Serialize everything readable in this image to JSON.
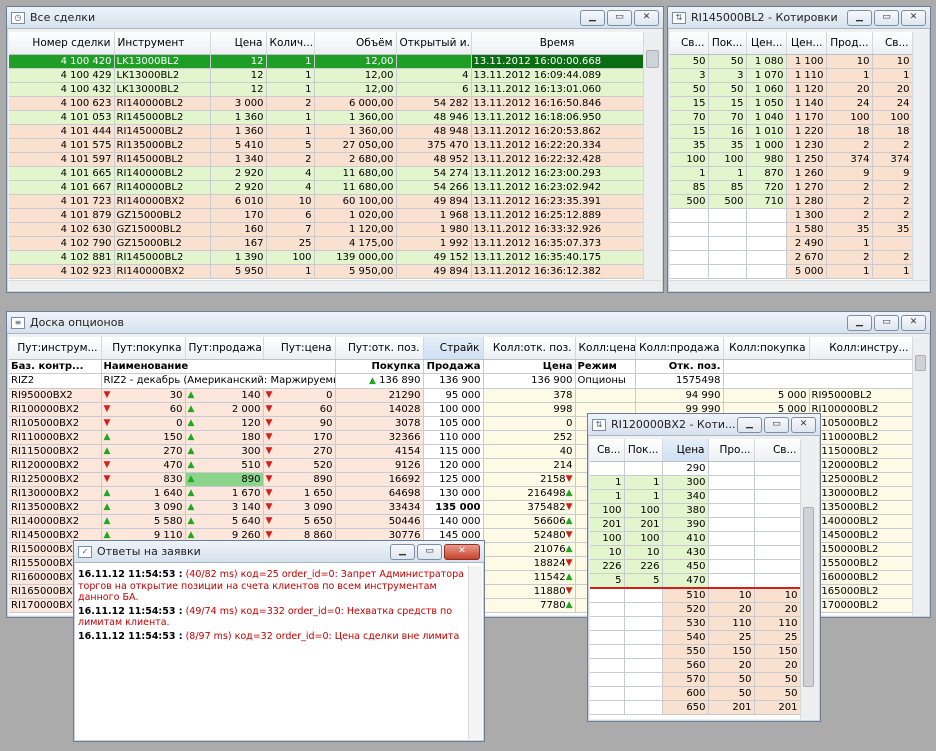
{
  "deals": {
    "title": "Все сделки",
    "icon": "deals-icon",
    "columns": [
      "Номер сделки",
      "Инструмент",
      "Цена",
      "Колич...",
      "Объём",
      "Открытый и...",
      "Время"
    ],
    "rows": [
      [
        "4 100 420",
        "LK13000BL2",
        "12",
        "1",
        "12,00",
        "",
        "13.11.2012 16:00:00.668",
        "sel"
      ],
      [
        "4 100 429",
        "LK13000BL2",
        "12",
        "1",
        "12,00",
        "4",
        "13.11.2012 16:09:44.089",
        "buy"
      ],
      [
        "4 100 432",
        "LK13000BL2",
        "12",
        "1",
        "12,00",
        "6",
        "13.11.2012 16:13:01.060",
        "buy"
      ],
      [
        "4 100 623",
        "RI140000BL2",
        "3 000",
        "2",
        "6 000,00",
        "54 282",
        "13.11.2012 16:16:50.846",
        "sale"
      ],
      [
        "4 101 053",
        "RI145000BL2",
        "1 360",
        "1",
        "1 360,00",
        "48 946",
        "13.11.2012 16:18:06.950",
        "buy"
      ],
      [
        "4 101 444",
        "RI145000BL2",
        "1 360",
        "1",
        "1 360,00",
        "48 948",
        "13.11.2012 16:20:53.862",
        "sale"
      ],
      [
        "4 101 575",
        "RI135000BL2",
        "5 410",
        "5",
        "27 050,00",
        "375 470",
        "13.11.2012 16:22:20.334",
        "sale"
      ],
      [
        "4 101 597",
        "RI145000BL2",
        "1 340",
        "2",
        "2 680,00",
        "48 952",
        "13.11.2012 16:22:32.428",
        "sale"
      ],
      [
        "4 101 665",
        "RI140000BL2",
        "2 920",
        "4",
        "11 680,00",
        "54 274",
        "13.11.2012 16:23:00.293",
        "buy"
      ],
      [
        "4 101 667",
        "RI140000BL2",
        "2 920",
        "4",
        "11 680,00",
        "54 266",
        "13.11.2012 16:23:02.942",
        "buy"
      ],
      [
        "4 101 723",
        "RI140000BX2",
        "6 010",
        "10",
        "60 100,00",
        "49 894",
        "13.11.2012 16:23:35.391",
        "sale"
      ],
      [
        "4 101 879",
        "GZ15000BL2",
        "170",
        "6",
        "1 020,00",
        "1 968",
        "13.11.2012 16:25:12.889",
        "sale"
      ],
      [
        "4 102 630",
        "GZ15000BL2",
        "160",
        "7",
        "1 120,00",
        "1 980",
        "13.11.2012 16:33:32.926",
        "sale"
      ],
      [
        "4 102 790",
        "GZ15000BL2",
        "167",
        "25",
        "4 175,00",
        "1 992",
        "13.11.2012 16:35:07.373",
        "sale"
      ],
      [
        "4 102 881",
        "RI145000BL2",
        "1 390",
        "100",
        "139 000,00",
        "49 152",
        "13.11.2012 16:35:40.175",
        "buy"
      ],
      [
        "4 102 923",
        "RI140000BX2",
        "5 950",
        "1",
        "5 950,00",
        "49 894",
        "13.11.2012 16:36:12.382",
        "sale"
      ]
    ]
  },
  "quotes1": {
    "title": "RI145000BL2 - Котировки",
    "icon": "quotes-icon",
    "columns": [
      "Св...",
      "Пок...",
      "Цен...",
      "Цен...",
      "Прод...",
      "Св..."
    ],
    "rows": [
      [
        "50",
        "50",
        "1 080",
        "1 100",
        "10",
        "10"
      ],
      [
        "3",
        "3",
        "1 070",
        "1 110",
        "1",
        "1"
      ],
      [
        "50",
        "50",
        "1 060",
        "1 120",
        "20",
        "20"
      ],
      [
        "15",
        "15",
        "1 050",
        "1 140",
        "24",
        "24"
      ],
      [
        "70",
        "70",
        "1 040",
        "1 170",
        "100",
        "100"
      ],
      [
        "15",
        "16",
        "1 010",
        "1 220",
        "18",
        "18"
      ],
      [
        "35",
        "35",
        "1 000",
        "1 230",
        "2",
        "2"
      ],
      [
        "100",
        "100",
        "980",
        "1 250",
        "374",
        "374"
      ],
      [
        "1",
        "1",
        "870",
        "1 260",
        "9",
        "9"
      ],
      [
        "85",
        "85",
        "720",
        "1 270",
        "2",
        "2"
      ],
      [
        "500",
        "500",
        "710",
        "1 280",
        "2",
        "2"
      ],
      [
        "",
        "",
        "",
        "1 300",
        "2",
        "2"
      ],
      [
        "",
        "",
        "",
        "1 580",
        "35",
        "35"
      ],
      [
        "",
        "",
        "",
        "2 490",
        "1",
        ""
      ],
      [
        "",
        "",
        "",
        "2 670",
        "2",
        "2"
      ],
      [
        "",
        "",
        "",
        "5 000",
        "1",
        "1"
      ]
    ]
  },
  "board": {
    "title": "Доска опционов",
    "icon": "board-icon",
    "columns": [
      "Пут:инструм...",
      "Пут:покупка",
      "Пут:продажа",
      "Пут:цена",
      "Пут:отк. поз.",
      "Страйк",
      "Колл:отк. поз.",
      "Колл:цена",
      "Колл:продажа",
      "Колл:покупка",
      "Колл:инстру..."
    ],
    "base_headers": [
      "Баз. контр...",
      "Наименование",
      "Покупка",
      "Продажа",
      "Цена",
      "Режим",
      "Отк. поз."
    ],
    "base_values": [
      "RIZ2",
      "RIZ2 - декабрь (Американский: Маржируемый)",
      "136 890",
      "136 900",
      "136 900",
      "Опционы",
      "1575498"
    ],
    "rows": [
      [
        "RI95000BX2",
        "",
        "30",
        "140",
        "0",
        "21290",
        "95 000",
        "378",
        "",
        "94 990",
        "5 000",
        "RI95000BL2"
      ],
      [
        "RI100000BX2",
        "",
        "60",
        "2 000",
        "60",
        "14028",
        "100 000",
        "998",
        "",
        "99 990",
        "5 000",
        "RI100000BL2"
      ],
      [
        "RI105000BX2",
        "",
        "0",
        "120",
        "90",
        "3078",
        "105 000",
        "0",
        "",
        "",
        "",
        "RI105000BL2"
      ],
      [
        "RI110000BX2",
        "",
        "150",
        "180",
        "170",
        "32366",
        "110 000",
        "252",
        "",
        "",
        "",
        "RI110000BL2"
      ],
      [
        "RI115000BX2",
        "",
        "270",
        "300",
        "270",
        "4154",
        "115 000",
        "40",
        "",
        "",
        "",
        "RI115000BL2"
      ],
      [
        "RI120000BX2",
        "",
        "470",
        "510",
        "520",
        "9126",
        "120 000",
        "214",
        "",
        "",
        "",
        "RI120000BL2"
      ],
      [
        "RI125000BX2",
        "",
        "830",
        "890",
        "890",
        "16692",
        "125 000",
        "2158",
        "",
        "",
        "",
        "RI125000BL2"
      ],
      [
        "RI130000BX2",
        "",
        "1 640",
        "1 670",
        "1 650",
        "64698",
        "130 000",
        "216498",
        "",
        "",
        "",
        "RI130000BL2"
      ],
      [
        "RI135000BX2",
        "",
        "3 090",
        "3 140",
        "3 090",
        "33434",
        "135 000",
        "375482",
        "",
        "",
        "",
        "RI135000BL2"
      ],
      [
        "RI140000BX2",
        "",
        "5 580",
        "5 640",
        "5 650",
        "50446",
        "140 000",
        "56606",
        "",
        "",
        "",
        "RI140000BL2"
      ],
      [
        "RI145000BX2",
        "",
        "9 110",
        "9 260",
        "8 860",
        "30776",
        "145 000",
        "52480",
        "",
        "",
        "",
        "RI145000BL2"
      ],
      [
        "RI150000BX2",
        "",
        "",
        "",
        "",
        "",
        "",
        "21076",
        "",
        "",
        "",
        "RI150000BL2"
      ],
      [
        "RI155000BX2",
        "",
        "",
        "",
        "",
        "",
        "",
        "18824",
        "",
        "",
        "",
        "RI155000BL2"
      ],
      [
        "RI160000BX2",
        "",
        "",
        "",
        "",
        "",
        "",
        "11542",
        "",
        "",
        "",
        "RI160000BL2"
      ],
      [
        "RI165000BX2",
        "",
        "",
        "",
        "",
        "",
        "",
        "11880",
        "",
        "",
        "",
        "RI165000BL2"
      ],
      [
        "RI170000BX2",
        "",
        "",
        "",
        "",
        "",
        "",
        "7780",
        "",
        "",
        "",
        "RI170000BL2"
      ]
    ]
  },
  "answers": {
    "title": "Ответы на заявки",
    "icon": "answers-icon",
    "messages": [
      {
        "time": "16.11.12 11:54:53 :",
        "text": "(40/82 ms) код=25 order_id=0: Запрет Администратора торгов на открытие позиции на счета клиентов по всем инструментам данного БА."
      },
      {
        "time": "16.11.12 11:54:53 :",
        "text": "(49/74 ms) код=332 order_id=0: Нехватка средств по лимитам клиента."
      },
      {
        "time": "16.11.12 11:54:53 :",
        "text": "(8/97 ms) код=32 order_id=0: Цена сделки вне лимита"
      }
    ]
  },
  "quotes2": {
    "title": "RI120000BX2 - Коти...",
    "icon": "quotes-icon",
    "columns": [
      "Св...",
      "Пок...",
      "Цена",
      "Про...",
      "Св..."
    ],
    "rows": [
      [
        "",
        "",
        "290",
        "",
        ""
      ],
      [
        "1",
        "1",
        "300",
        "",
        ""
      ],
      [
        "1",
        "1",
        "340",
        "",
        ""
      ],
      [
        "100",
        "100",
        "380",
        "",
        ""
      ],
      [
        "201",
        "201",
        "390",
        "",
        ""
      ],
      [
        "100",
        "100",
        "410",
        "",
        ""
      ],
      [
        "10",
        "10",
        "430",
        "",
        ""
      ],
      [
        "226",
        "226",
        "450",
        "",
        ""
      ],
      [
        "5",
        "5",
        "470",
        "",
        ""
      ],
      [
        "",
        "",
        "510",
        "10",
        "10"
      ],
      [
        "",
        "",
        "520",
        "20",
        "20"
      ],
      [
        "",
        "",
        "530",
        "110",
        "110"
      ],
      [
        "",
        "",
        "540",
        "25",
        "25"
      ],
      [
        "",
        "",
        "550",
        "150",
        "150"
      ],
      [
        "",
        "",
        "560",
        "20",
        "20"
      ],
      [
        "",
        "",
        "570",
        "50",
        "50"
      ],
      [
        "",
        "",
        "600",
        "50",
        "50"
      ],
      [
        "",
        "",
        "650",
        "201",
        "201"
      ]
    ]
  }
}
